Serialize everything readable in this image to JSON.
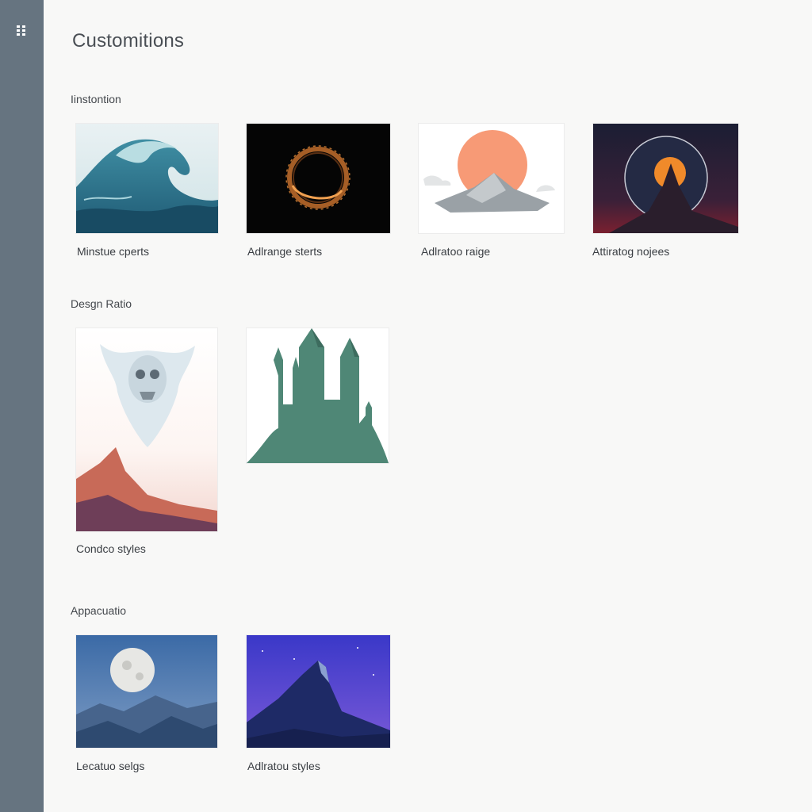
{
  "header": {
    "title": "Customitions",
    "menu_icon": "grid-menu-icon"
  },
  "sections": [
    {
      "title": "Iinstontion",
      "cards": [
        {
          "label": "Minstue cperts",
          "image": "ocean-wave-illustration"
        },
        {
          "label": "Adlrange sterts",
          "image": "glowing-ring-illustration"
        },
        {
          "label": "Adlratoo raige",
          "image": "sun-over-mountain-illustration"
        },
        {
          "label": "Attiratog nojees",
          "image": "moon-volcano-illustration"
        }
      ]
    },
    {
      "title": "Desgn Ratio",
      "cards": [
        {
          "label": "Condco styles",
          "image": "ghost-over-mountains-illustration"
        },
        {
          "label": "",
          "image": "green-castle-illustration"
        }
      ]
    },
    {
      "title": "Appacuatio",
      "cards": [
        {
          "label": "Lecatuo selgs",
          "image": "full-moon-mountains-illustration"
        },
        {
          "label": "Adlratou styles",
          "image": "purple-peak-illustration"
        }
      ]
    }
  ],
  "colors": {
    "sidebar": "#667480",
    "background": "#f8f8f7",
    "text": "#3b3f44"
  }
}
